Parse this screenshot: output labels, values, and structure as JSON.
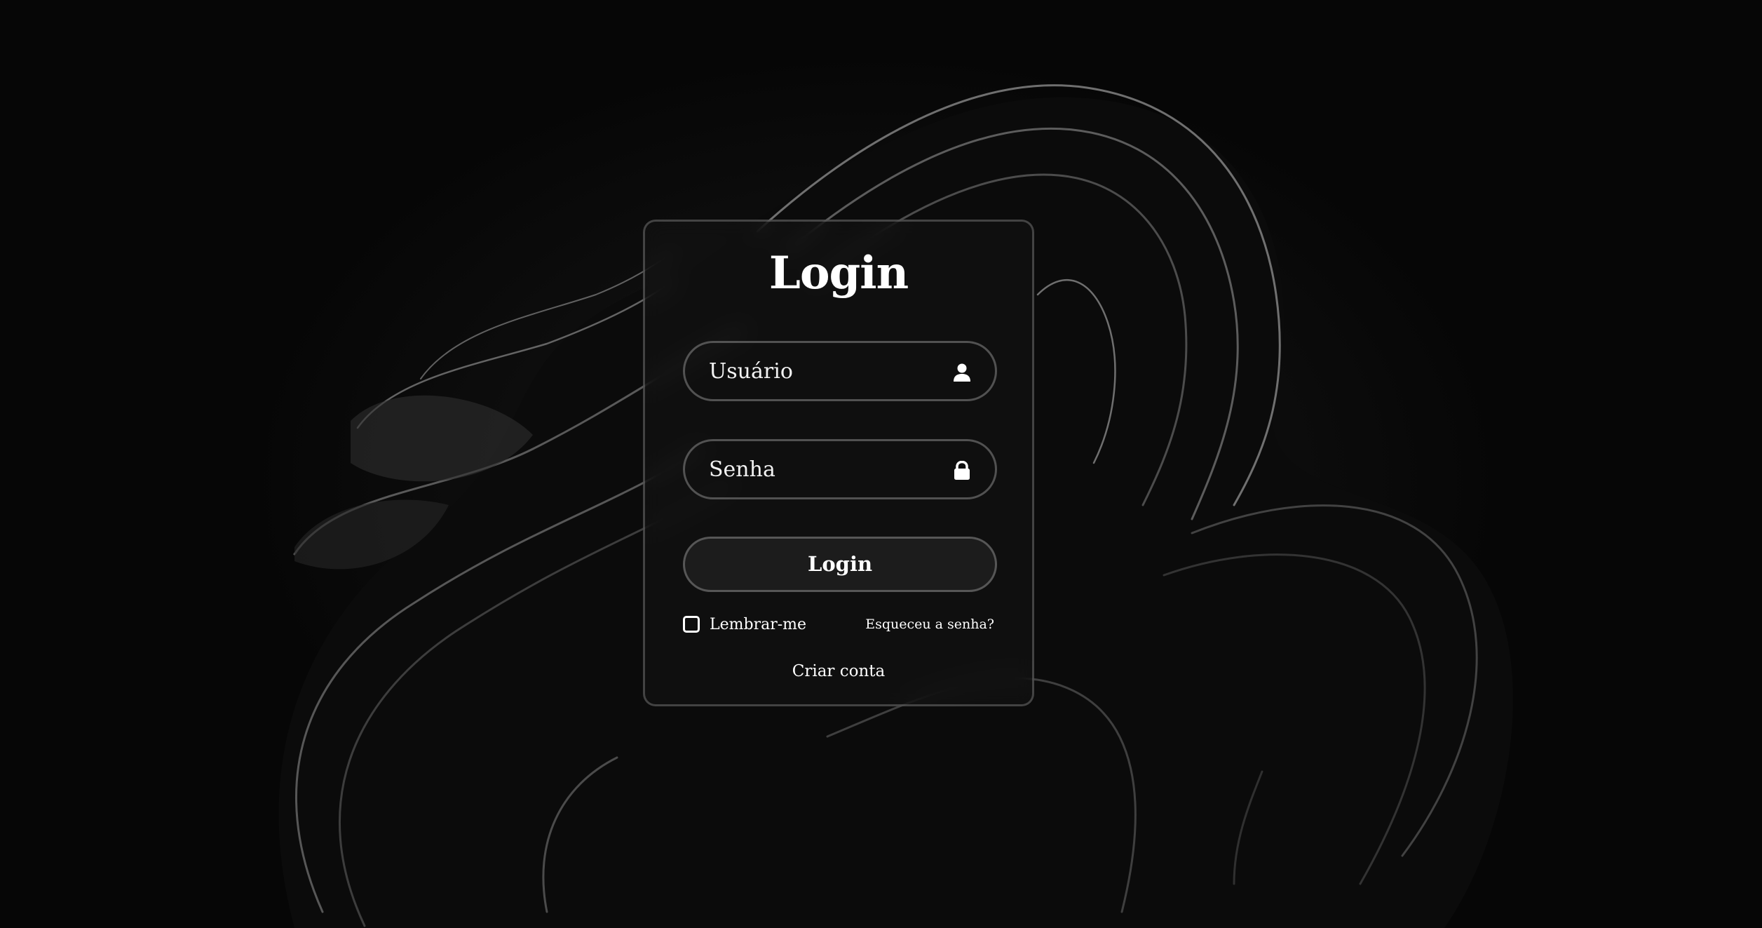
{
  "theme": {
    "background": "#050505",
    "card_border": "rgba(255,255,255,0.22)",
    "text": "#ffffff"
  },
  "login_form": {
    "title": "Login",
    "username": {
      "placeholder": "Usuário",
      "value": "",
      "icon": "user-icon"
    },
    "password": {
      "placeholder": "Senha",
      "value": "",
      "icon": "lock-icon"
    },
    "submit_label": "Login",
    "remember_label": "Lembrar-me",
    "remember_checked": false,
    "forgot_label": "Esqueceu a senha?",
    "create_account_label": "Criar conta"
  }
}
